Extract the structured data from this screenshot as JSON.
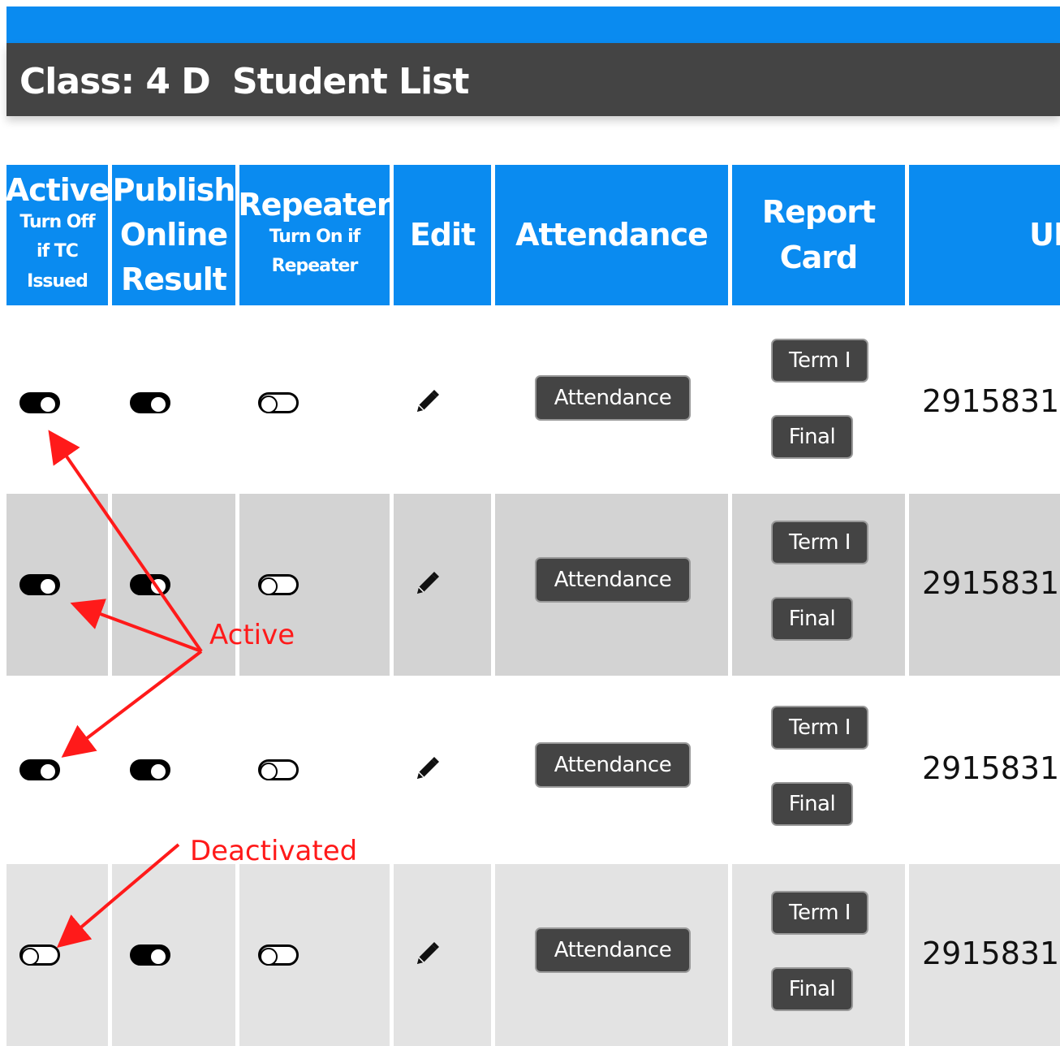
{
  "header": {
    "class_label": "Class: 4 D",
    "page_title": "Student List"
  },
  "columns": {
    "active": {
      "title": "Active",
      "subtitle_1": "Turn Off",
      "subtitle_2": "if TC",
      "subtitle_3": "Issued"
    },
    "publish": {
      "line_1": "Publish",
      "line_2": "Online",
      "line_3": "Result"
    },
    "repeater": {
      "title": "Repeater",
      "subtitle_1": "Turn On if",
      "subtitle_2": "Repeater"
    },
    "edit": "Edit",
    "attendance": "Attendance",
    "report_card": {
      "line_1": "Report",
      "line_2": "Card"
    },
    "ub_truncated": "UB"
  },
  "rows": [
    {
      "active": true,
      "publish": true,
      "repeater": false,
      "attendance_button": "Attendance",
      "term_button": "Term I",
      "final_button": "Final",
      "ub": "2915831"
    },
    {
      "active": true,
      "publish": true,
      "repeater": false,
      "attendance_button": "Attendance",
      "term_button": "Term I",
      "final_button": "Final",
      "ub": "2915831"
    },
    {
      "active": true,
      "publish": true,
      "repeater": false,
      "attendance_button": "Attendance",
      "term_button": "Term I",
      "final_button": "Final",
      "ub": "2915831"
    },
    {
      "active": false,
      "publish": true,
      "repeater": false,
      "attendance_button": "Attendance",
      "term_button": "Term I",
      "final_button": "Final",
      "ub": "2915831"
    }
  ],
  "annotations": {
    "active": "Active",
    "deactivated": "Deactivated"
  },
  "icons": {
    "edit": "pencil-icon",
    "toggle": "toggle-switch-icon"
  },
  "colors": {
    "header_blue": "#0a8bf0",
    "title_bar": "#444444",
    "row_shade": "#d3d3d3",
    "annotation": "#ff1a1a"
  }
}
